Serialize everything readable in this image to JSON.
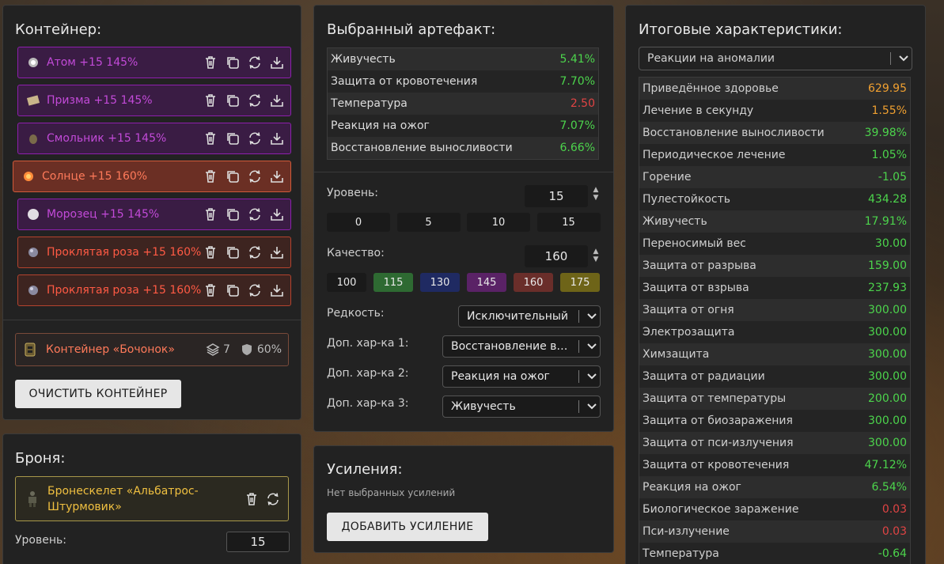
{
  "container_panel": {
    "title": "Контейнер:",
    "items": [
      {
        "label": "Атом +15 145%",
        "tone": "purple"
      },
      {
        "label": "Призма +15 145%",
        "tone": "purple"
      },
      {
        "label": "Смольник +15 145%",
        "tone": "purple"
      },
      {
        "label": "Солнце +15 160%",
        "tone": "orange"
      },
      {
        "label": "Морозец +15 145%",
        "tone": "purple"
      },
      {
        "label": "Проклятая роза +15 160%",
        "tone": "red"
      },
      {
        "label": "Проклятая роза +15 160%",
        "tone": "red"
      }
    ],
    "container": {
      "name": "Контейнер «Бочонок»",
      "slots": "7",
      "protection": "60%"
    },
    "clear_button": "ОЧИСТИТЬ КОНТЕЙНЕР"
  },
  "armor_panel": {
    "title": "Броня:",
    "armor_name": "Бронескелет «Альбатрос-Штурмовик»",
    "level_label": "Уровень:",
    "level_value": "15"
  },
  "artifact_panel": {
    "title": "Выбранный артефакт:",
    "stats": [
      {
        "name": "Живучесть",
        "value": "5.41%",
        "color": "green"
      },
      {
        "name": "Защита от кровотечения",
        "value": "7.70%",
        "color": "green"
      },
      {
        "name": "Температура",
        "value": "2.50",
        "color": "red"
      },
      {
        "name": "Реакция на ожог",
        "value": "7.07%",
        "color": "green"
      },
      {
        "name": "Восстановление выносливости",
        "value": "6.66%",
        "color": "green"
      }
    ],
    "level_label": "Уровень:",
    "level_value": "15",
    "level_presets": [
      "0",
      "5",
      "10",
      "15"
    ],
    "quality_label": "Качество:",
    "quality_value": "160",
    "quality_presets": [
      {
        "label": "100",
        "color": "#1a1a1a"
      },
      {
        "label": "115",
        "color": "#2e6a32"
      },
      {
        "label": "130",
        "color": "#1f2a62"
      },
      {
        "label": "145",
        "color": "#5a2266"
      },
      {
        "label": "160",
        "color": "#6a2e2a"
      },
      {
        "label": "175",
        "color": "#6e6418"
      }
    ],
    "rarity_label": "Редкость:",
    "rarity_value": "Исключительный",
    "extra1_label": "Доп. хар-ка 1:",
    "extra1_value": "Восстановление выносливости",
    "extra2_label": "Доп. хар-ка 2:",
    "extra2_value": "Реакция на ожог",
    "extra3_label": "Доп. хар-ка 3:",
    "extra3_value": "Живучесть"
  },
  "boost_panel": {
    "title": "Усиления:",
    "empty_text": "Нет выбранных усилений",
    "add_button": "ДОБАВИТЬ УСИЛЕНИЕ"
  },
  "totals_panel": {
    "title": "Итоговые характеристики:",
    "filter_value": "Реакции на аномалии",
    "rows": [
      {
        "name": "Приведённое здоровье",
        "value": "629.95",
        "color": "orange"
      },
      {
        "name": "Лечение в секунду",
        "value": "1.55%",
        "color": "orange"
      },
      {
        "name": "Восстановление выносливости",
        "value": "39.98%",
        "color": "green"
      },
      {
        "name": "Периодическое лечение",
        "value": "1.05%",
        "color": "green"
      },
      {
        "name": "Горение",
        "value": "-1.05",
        "color": "green"
      },
      {
        "name": "Пулестойкость",
        "value": "434.28",
        "color": "green"
      },
      {
        "name": "Живучесть",
        "value": "17.91%",
        "color": "green"
      },
      {
        "name": "Переносимый вес",
        "value": "30.00",
        "color": "green"
      },
      {
        "name": "Защита от разрыва",
        "value": "159.00",
        "color": "green"
      },
      {
        "name": "Защита от взрыва",
        "value": "237.93",
        "color": "green"
      },
      {
        "name": "Защита от огня",
        "value": "300.00",
        "color": "green"
      },
      {
        "name": "Электрозащита",
        "value": "300.00",
        "color": "green"
      },
      {
        "name": "Химзащита",
        "value": "300.00",
        "color": "green"
      },
      {
        "name": "Защита от радиации",
        "value": "300.00",
        "color": "green"
      },
      {
        "name": "Защита от температуры",
        "value": "200.00",
        "color": "green"
      },
      {
        "name": "Защита от биозаражения",
        "value": "300.00",
        "color": "green"
      },
      {
        "name": "Защита от пси-излучения",
        "value": "300.00",
        "color": "green"
      },
      {
        "name": "Защита от кровотечения",
        "value": "47.12%",
        "color": "green"
      },
      {
        "name": "Реакция на ожог",
        "value": "6.54%",
        "color": "green"
      },
      {
        "name": "Биологическое заражение",
        "value": "0.03",
        "color": "red"
      },
      {
        "name": "Пси-излучение",
        "value": "0.03",
        "color": "red"
      },
      {
        "name": "Температура",
        "value": "-0.64",
        "color": "green"
      }
    ]
  }
}
